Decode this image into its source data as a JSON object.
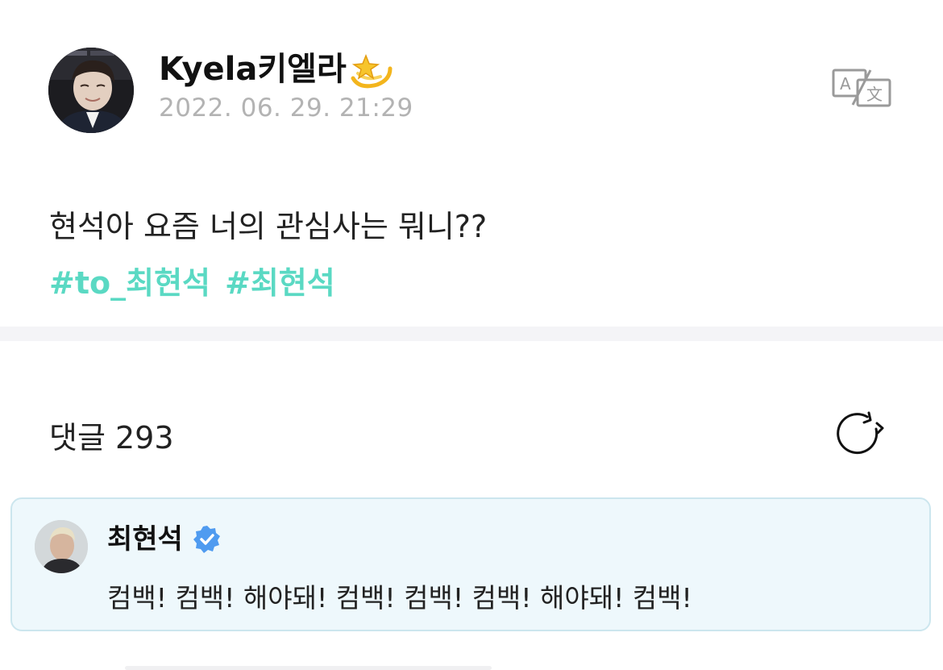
{
  "post": {
    "author": "Kyela키엘라",
    "author_emoji": "dizzy-star-emoji",
    "timestamp": "2022. 06. 29. 21:29",
    "text": "현석아 요즘 너의 관심사는 뭐니??",
    "hashtags": [
      "#to_최현석",
      "#최현석"
    ],
    "translate_icon": "translate-icon"
  },
  "comments": {
    "label": "댓글 293",
    "refresh_icon": "refresh-icon",
    "highlighted": {
      "author": "최현석",
      "verified_icon": "verified-badge-icon",
      "text": "컴백! 컴백! 해야돼! 컴백! 컴백! 컴백! 해야돼! 컴백!"
    }
  },
  "colors": {
    "hashtag": "#5ad9c3",
    "timestamp": "#b3b3b3",
    "comment_bg": "#eef8fc",
    "comment_border": "#cce6ee",
    "verified": "#4f9bf0",
    "divider": "#f4f4f7"
  }
}
